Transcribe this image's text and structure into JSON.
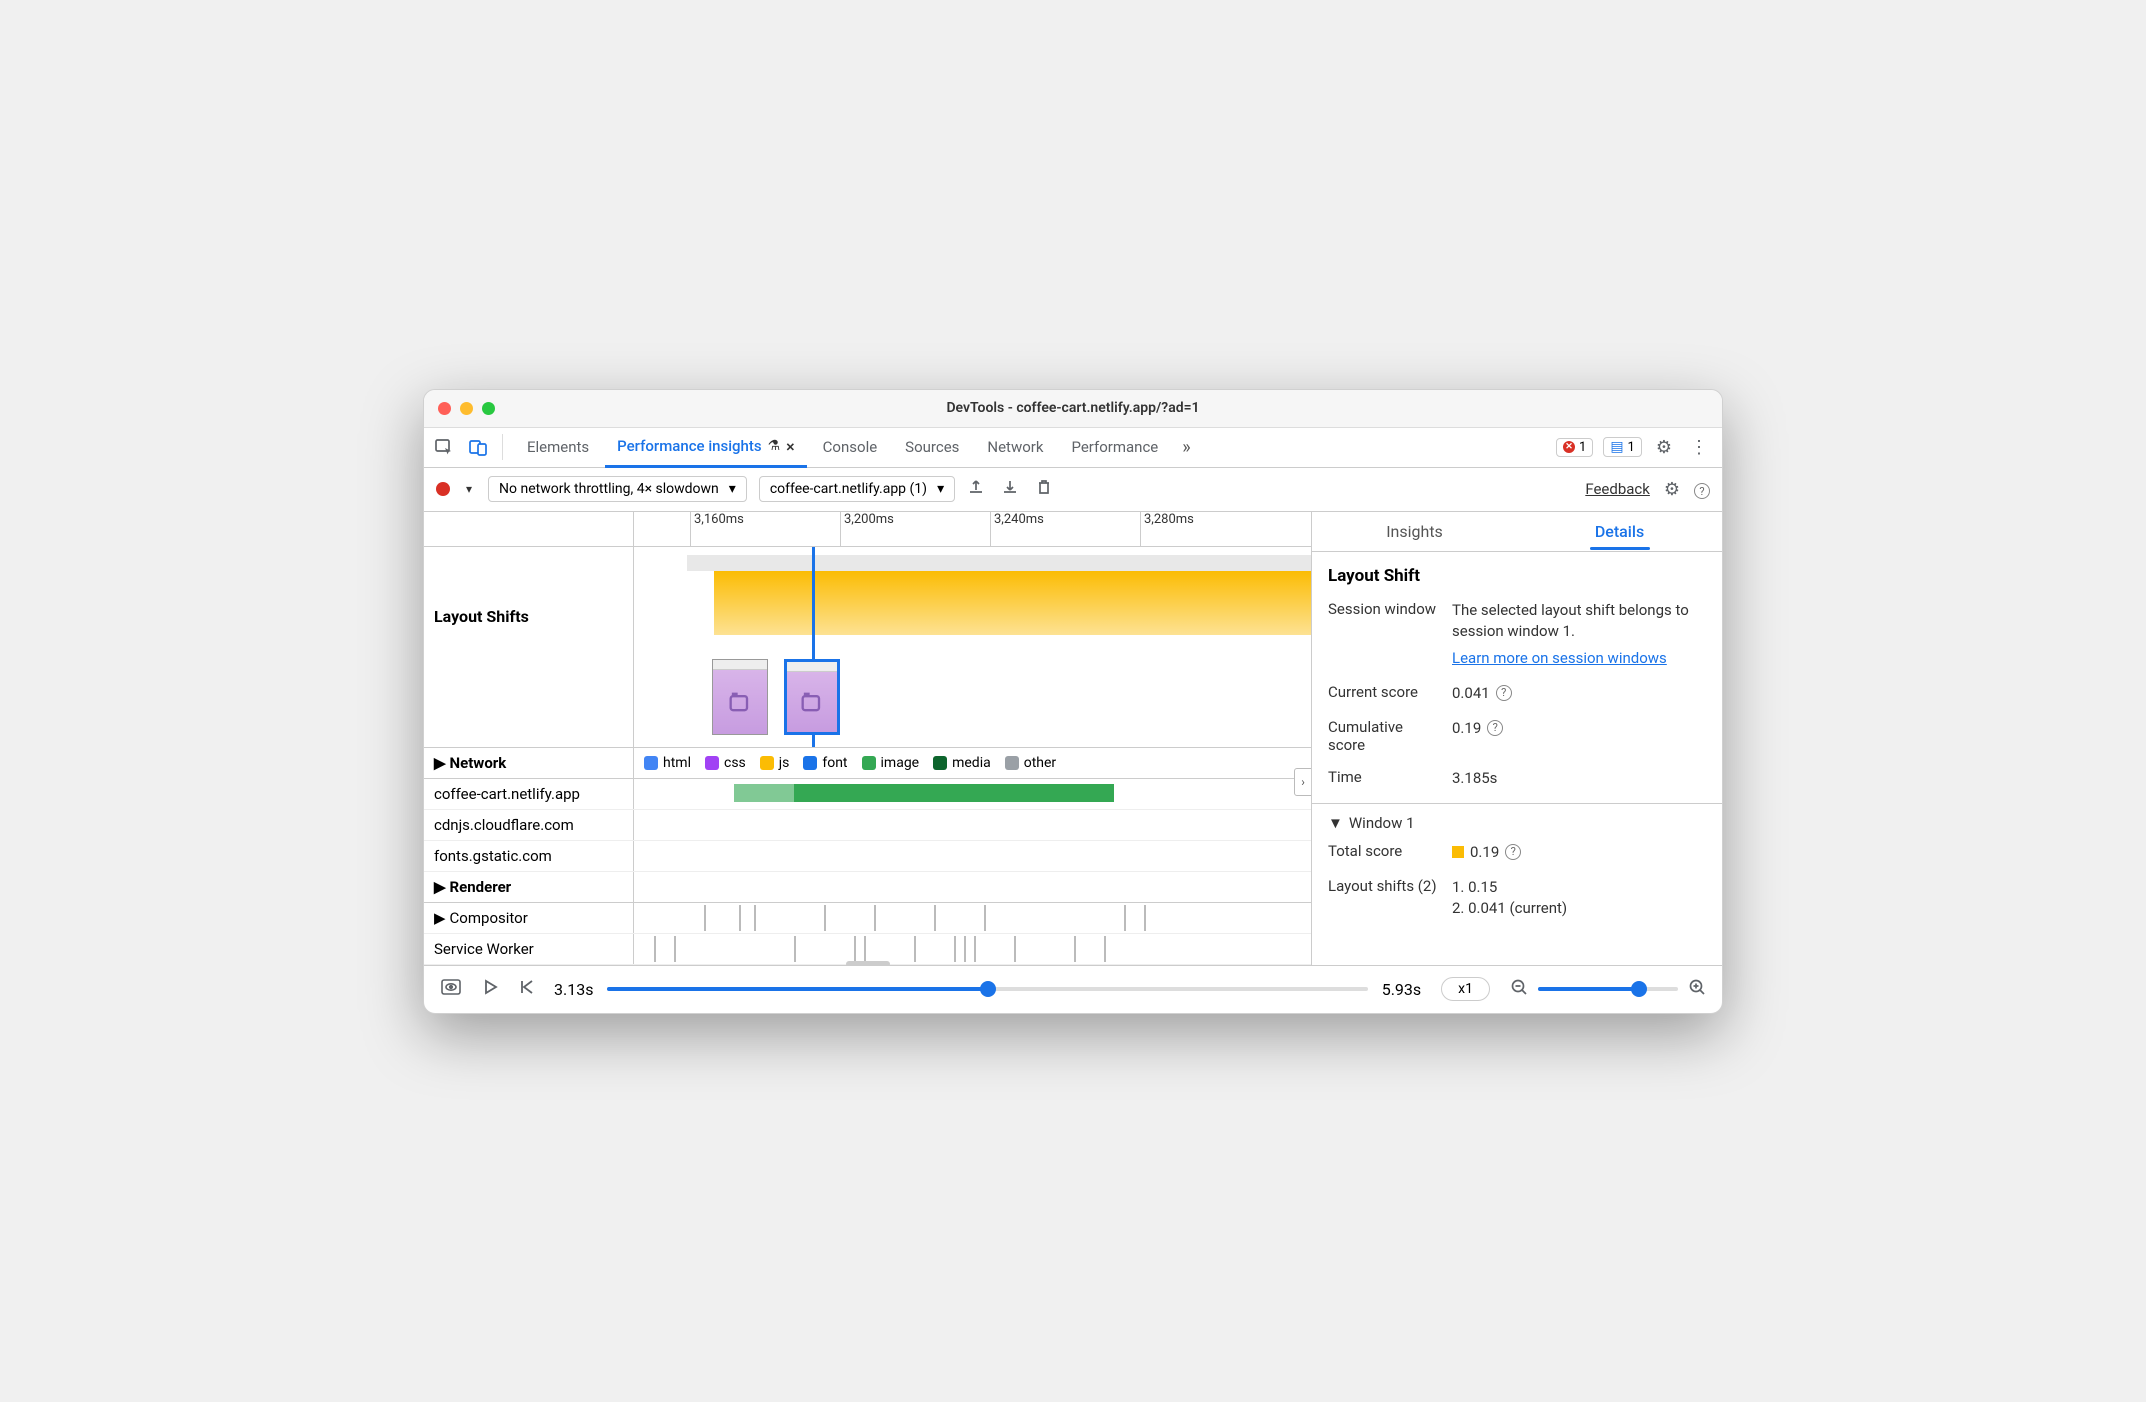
{
  "window": {
    "title": "DevTools - coffee-cart.netlify.app/?ad=1"
  },
  "tabs": {
    "items": [
      "Elements",
      "Performance insights",
      "Console",
      "Sources",
      "Network",
      "Performance"
    ],
    "active_index": 1,
    "badges": {
      "errors": "1",
      "messages": "1"
    }
  },
  "toolbar": {
    "throttle": "No network throttling, 4× slowdown",
    "target": "coffee-cart.netlify.app (1)",
    "feedback": "Feedback"
  },
  "ruler": {
    "ticks": [
      "3,160ms",
      "3,200ms",
      "3,240ms",
      "3,280ms"
    ]
  },
  "layout_shifts": {
    "label": "Layout Shifts"
  },
  "network": {
    "header": "Network",
    "legend": [
      "html",
      "css",
      "js",
      "font",
      "image",
      "media",
      "other"
    ],
    "hosts": [
      "coffee-cart.netlify.app",
      "cdnjs.cloudflare.com",
      "fonts.gstatic.com"
    ]
  },
  "renderer": {
    "header": "Renderer",
    "rows": [
      "Compositor",
      "Service Worker"
    ]
  },
  "footer": {
    "start": "3.13s",
    "end": "5.93s",
    "speed": "x1"
  },
  "sidebar": {
    "tabs": [
      "Insights",
      "Details"
    ],
    "active_index": 1,
    "section_title": "Layout Shift",
    "session_window": {
      "label": "Session window",
      "text_pre": "The selected layout shift belongs to session window 1. ",
      "link": "Learn more on session windows"
    },
    "current_score": {
      "label": "Current score",
      "value": "0.041"
    },
    "cumulative_score": {
      "label": "Cumulative score",
      "value": "0.19"
    },
    "time": {
      "label": "Time",
      "value": "3.185s"
    },
    "window1": {
      "header": "Window 1",
      "total_score": {
        "label": "Total score",
        "value": "0.19"
      },
      "shifts": {
        "label": "Layout shifts (2)",
        "items": [
          "1. 0.15",
          "2. 0.041 (current)"
        ]
      }
    }
  }
}
